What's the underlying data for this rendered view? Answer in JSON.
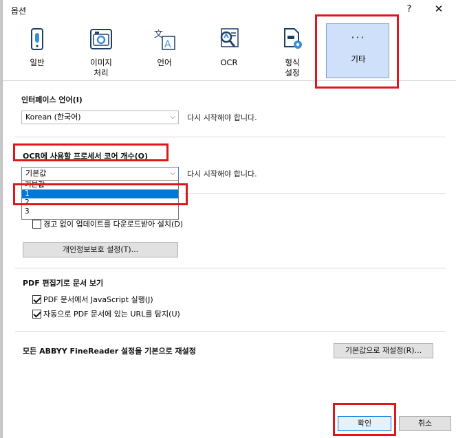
{
  "dialog": {
    "title": "옵션",
    "help_label": "?",
    "close_label": "✕"
  },
  "toolbar": {
    "items": [
      {
        "label": "일반",
        "icon": "phone-settings-icon"
      },
      {
        "label": "이미지\n처리",
        "icon": "camera-icon"
      },
      {
        "label": "언어",
        "icon": "translate-icon"
      },
      {
        "label": "OCR",
        "icon": "ocr-magnifier-icon"
      },
      {
        "label": "형식\n설정",
        "icon": "document-gear-icon"
      },
      {
        "label": "기타",
        "icon": "more-dots-icon",
        "selected": true
      }
    ],
    "more_dots": "···"
  },
  "interface_language": {
    "label": "인터페이스 언어(I)",
    "value": "Korean (한국어)",
    "note": "다시 시작해야 합니다."
  },
  "ocr_cores": {
    "label": "OCR에 사용할 프로세서 코어 개수(O)",
    "value": "기본값",
    "note": "다시 시작해야 합니다.",
    "options": [
      "기본값",
      "1",
      "2",
      "3"
    ],
    "highlighted_option": "1"
  },
  "updates": {
    "checkbox_label": "경고 없이 업데이트를 다운로드받아 설치(D)",
    "checked": false,
    "privacy_button": "개인정보보호 설정(T)..."
  },
  "pdf_editor": {
    "label": "PDF 편집기로 문서 보기",
    "js_label": "PDF 문서에서 JavaScript 실행(J)",
    "js_checked": true,
    "url_label": "자동으로 PDF 문서에 있는 URL를 탐지(U)",
    "url_checked": true
  },
  "reset": {
    "label": "모든 ABBYY FineReader 설정을 기본으로 재설정",
    "button": "기본값으로 재설정(R)..."
  },
  "footer": {
    "ok": "확인",
    "cancel": "취소"
  },
  "colors": {
    "highlight": "#e0161b",
    "selection": "#0078d7",
    "selected_tab": "#cfe0fa"
  }
}
